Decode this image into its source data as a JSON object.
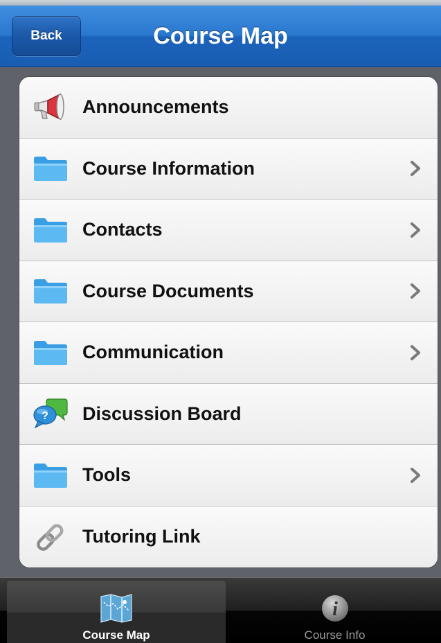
{
  "navbar": {
    "back_label": "Back",
    "title": "Course Map"
  },
  "list": {
    "items": [
      {
        "label": "Announcements",
        "icon": "megaphone-icon",
        "has_chevron": false
      },
      {
        "label": "Course Information",
        "icon": "folder-icon",
        "has_chevron": true
      },
      {
        "label": "Contacts",
        "icon": "folder-icon",
        "has_chevron": true
      },
      {
        "label": "Course Documents",
        "icon": "folder-icon",
        "has_chevron": true
      },
      {
        "label": "Communication",
        "icon": "folder-icon",
        "has_chevron": true
      },
      {
        "label": "Discussion Board",
        "icon": "speech-bubbles-icon",
        "has_chevron": false
      },
      {
        "label": "Tools",
        "icon": "folder-icon",
        "has_chevron": true
      },
      {
        "label": "Tutoring Link",
        "icon": "chain-link-icon",
        "has_chevron": false
      }
    ]
  },
  "tabbar": {
    "tabs": [
      {
        "label": "Course Map",
        "icon": "map-icon",
        "selected": true
      },
      {
        "label": "Course Info",
        "icon": "info-icon",
        "selected": false
      }
    ]
  },
  "colors": {
    "nav_blue": "#2a78cf",
    "folder_blue": "#3aa3e8",
    "list_bg": "#f4f4f4",
    "tabbar_bg": "#000000"
  }
}
